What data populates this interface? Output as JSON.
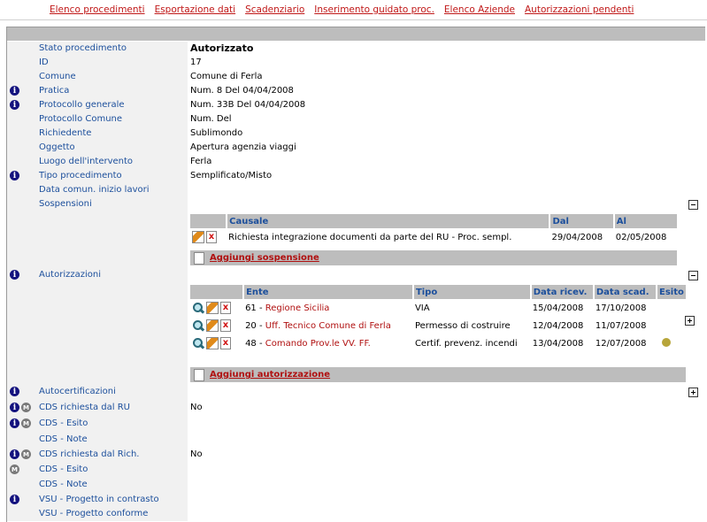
{
  "nav": [
    "Elenco procedimenti",
    "Esportazione dati",
    "Scadenziario",
    "Inserimento guidato proc.",
    "Elenco Aziende",
    "Autorizzazioni pendenti"
  ],
  "fields": {
    "stato": {
      "label": "Stato procedimento",
      "value": "Autorizzato"
    },
    "id": {
      "label": "ID",
      "value": "17"
    },
    "comune": {
      "label": "Comune",
      "value": "Comune di Ferla"
    },
    "pratica": {
      "label": "Pratica",
      "value": "Num. 8   Del 04/04/2008"
    },
    "protgen": {
      "label": "Protocollo generale",
      "value": "Num. 33B   Del 04/04/2008"
    },
    "protcom": {
      "label": "Protocollo Comune",
      "value": "Num.    Del"
    },
    "rich": {
      "label": "Richiedente",
      "value": "Sublimondo"
    },
    "ogg": {
      "label": "Oggetto",
      "value": "Apertura agenzia viaggi"
    },
    "luogo": {
      "label": "Luogo dell'intervento",
      "value": "Ferla"
    },
    "tipo": {
      "label": "Tipo procedimento",
      "value": "Semplificato/Misto"
    },
    "datacom": {
      "label": "Data comun. inizio lavori",
      "value": ""
    },
    "sosp": {
      "label": "Sospensioni",
      "value": ""
    },
    "autor": {
      "label": "Autorizzazioni",
      "value": ""
    },
    "autocert": {
      "label": "Autocertificazioni",
      "value": ""
    },
    "cdsru": {
      "label": "CDS richiesta dal RU",
      "value": "No"
    },
    "cdsesito": {
      "label": "CDS - Esito",
      "value": ""
    },
    "cdsnote": {
      "label": "CDS - Note",
      "value": ""
    },
    "cdsrich": {
      "label": "CDS richiesta dal Rich.",
      "value": "No"
    },
    "cdsesito2": {
      "label": "CDS - Esito",
      "value": ""
    },
    "cdsnote2": {
      "label": "CDS - Note",
      "value": ""
    },
    "vsu1": {
      "label": "VSU - Progetto in contrasto",
      "value": ""
    },
    "vsu2": {
      "label": "VSU - Progetto conforme",
      "value": ""
    }
  },
  "sospensioni": {
    "headers": [
      "Causale",
      "Dal",
      "Al"
    ],
    "rows": [
      {
        "causale": "Richiesta integrazione documenti da parte del RU - Proc. sempl.",
        "dal": "29/04/2008",
        "al": "02/05/2008"
      }
    ],
    "add": "Aggiungi sospensione"
  },
  "autorizzazioni": {
    "headers": [
      "Ente",
      "Tipo",
      "Data ricev.",
      "Data scad.",
      "Esito"
    ],
    "rows": [
      {
        "num": "61 -",
        "ente": "Regione Sicilia",
        "tipo": "VIA",
        "ricev": "15/04/2008",
        "scad": "17/10/2008"
      },
      {
        "num": "20 -",
        "ente": "Uff. Tecnico Comune di Ferla",
        "tipo": "Permesso di costruire",
        "ricev": "12/04/2008",
        "scad": "11/07/2008"
      },
      {
        "num": "48 -",
        "ente": "Comando Prov.le VV. FF.",
        "tipo": "Certif. prevenz. incendi",
        "ricev": "13/04/2008",
        "scad": "12/07/2008"
      }
    ],
    "add": "Aggiungi autorizzazione"
  },
  "colors": {
    "link": "#c01818",
    "label": "#1c4f9c",
    "header": "#bdbdbd",
    "info": "#13127e"
  }
}
